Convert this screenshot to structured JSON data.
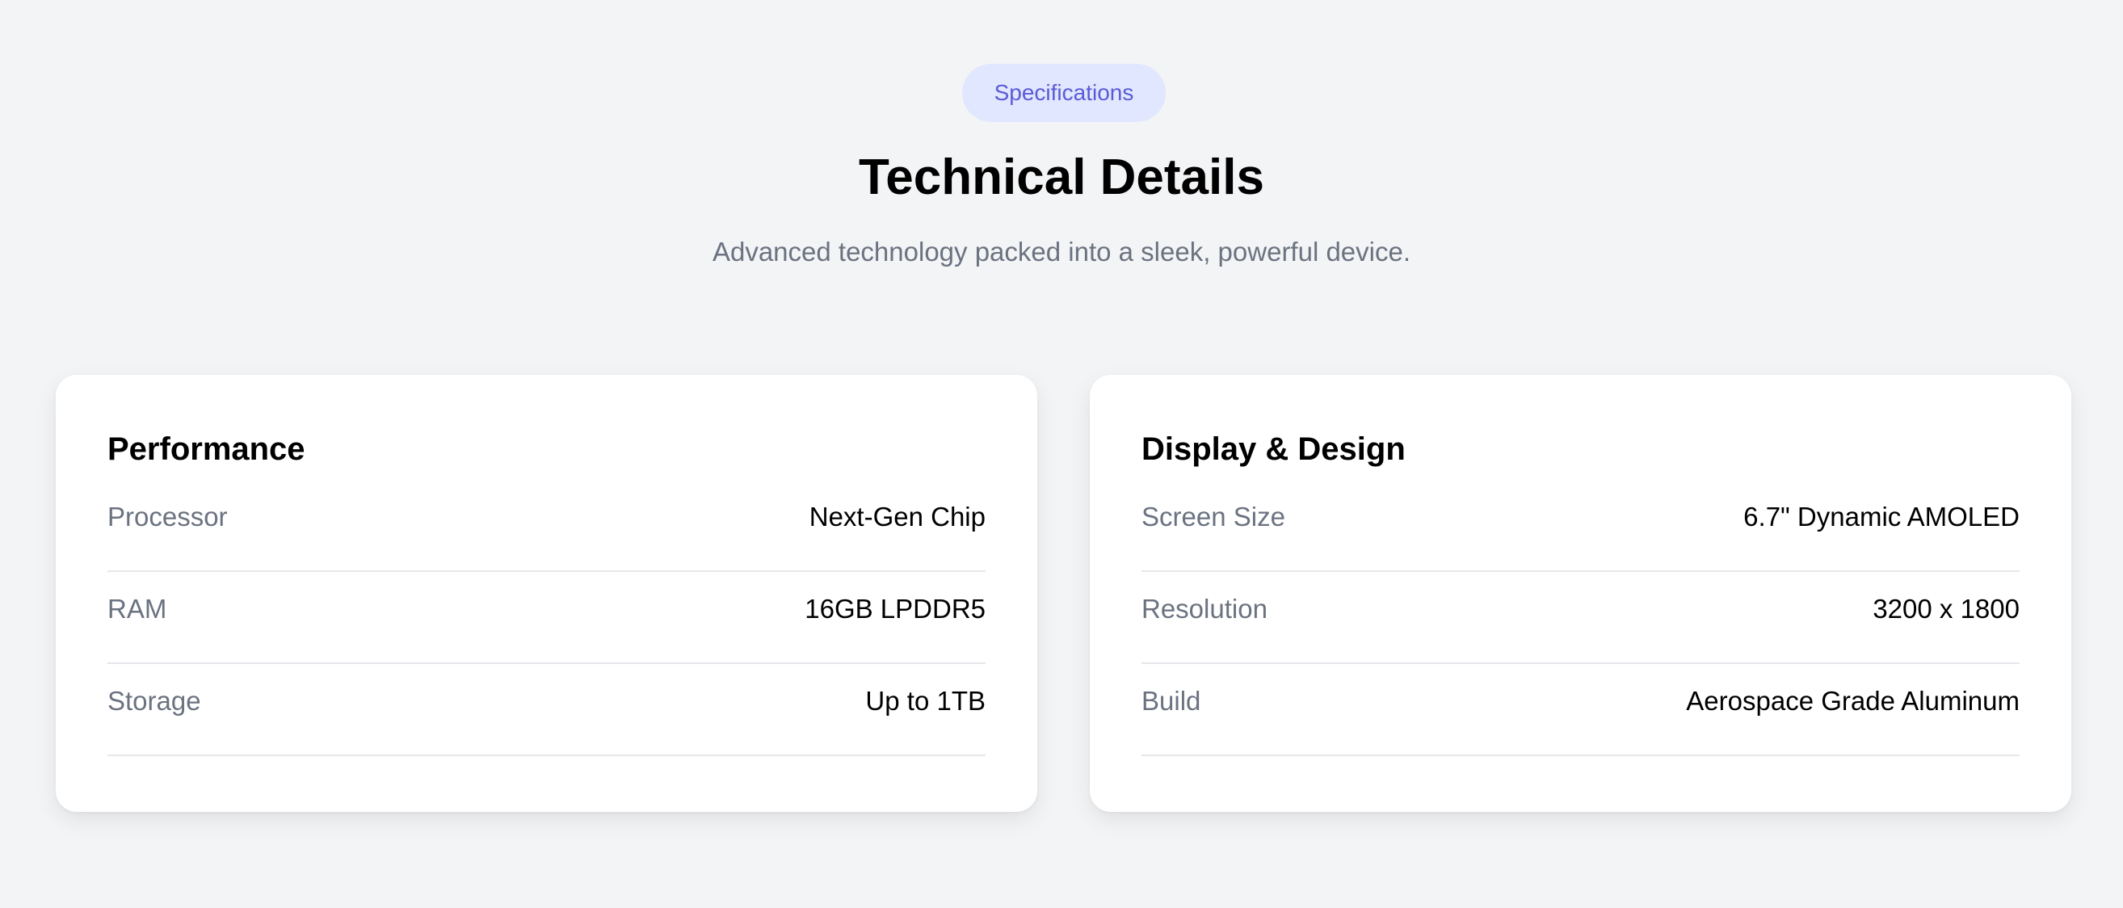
{
  "header": {
    "badge": "Specifications",
    "title": "Technical Details",
    "subtitle": "Advanced technology packed into a sleek, powerful device."
  },
  "cards": [
    {
      "title": "Performance",
      "rows": [
        {
          "label": "Processor",
          "value": "Next-Gen Chip"
        },
        {
          "label": "RAM",
          "value": "16GB LPDDR5"
        },
        {
          "label": "Storage",
          "value": "Up to 1TB"
        }
      ]
    },
    {
      "title": "Display & Design",
      "rows": [
        {
          "label": "Screen Size",
          "value": "6.7\" Dynamic AMOLED"
        },
        {
          "label": "Resolution",
          "value": "3200 x 1800"
        },
        {
          "label": "Build",
          "value": "Aerospace Grade Aluminum"
        }
      ]
    }
  ]
}
